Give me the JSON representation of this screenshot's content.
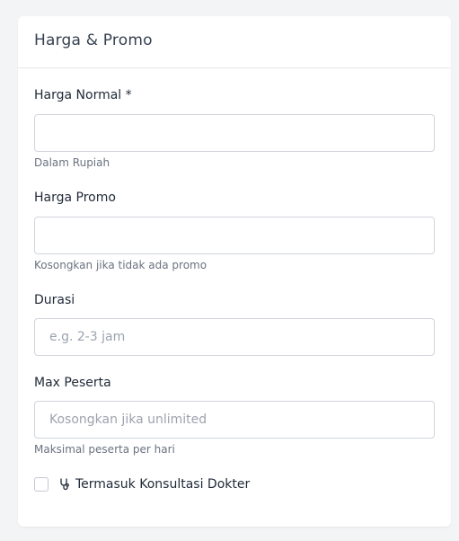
{
  "card": {
    "title": "Harga & Promo"
  },
  "fields": {
    "harga_normal": {
      "label": "Harga Normal *",
      "value": "",
      "placeholder": "",
      "help": "Dalam Rupiah"
    },
    "harga_promo": {
      "label": "Harga Promo",
      "value": "",
      "placeholder": "",
      "help": "Kosongkan jika tidak ada promo"
    },
    "durasi": {
      "label": "Durasi",
      "value": "",
      "placeholder": "e.g. 2-3 jam"
    },
    "max_peserta": {
      "label": "Max Peserta",
      "value": "",
      "placeholder": "Kosongkan jika unlimited",
      "help": "Maksimal peserta per hari"
    }
  },
  "checkbox": {
    "icon": "stethoscope-icon",
    "label": "Termasuk Konsultasi Dokter",
    "checked": false
  }
}
